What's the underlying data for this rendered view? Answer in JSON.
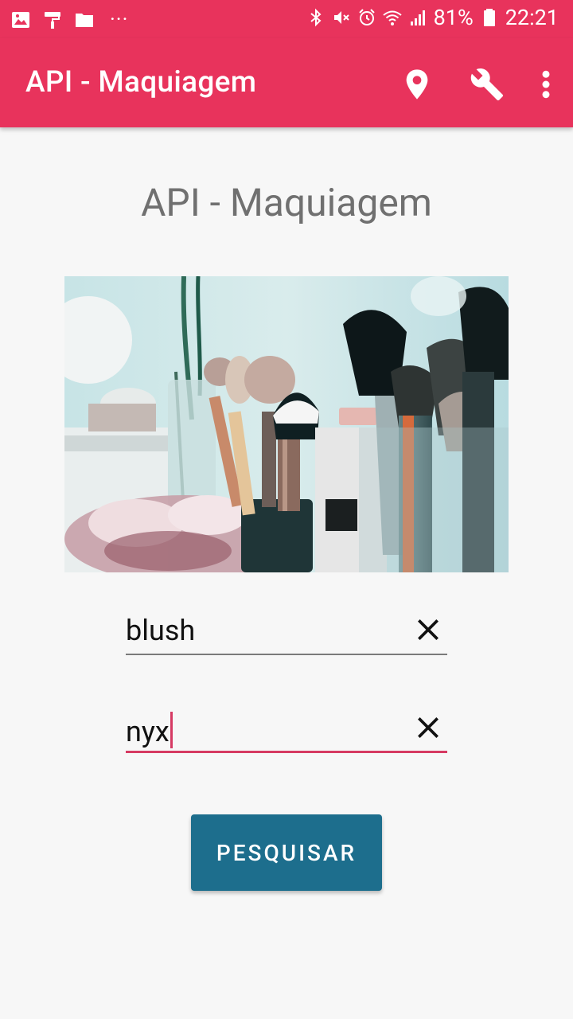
{
  "status_bar": {
    "battery": "81%",
    "time": "22:21",
    "more": "···"
  },
  "app_bar": {
    "title": "API - Maquiagem"
  },
  "main": {
    "title": "API - Maquiagem"
  },
  "form": {
    "product_type_value": "blush",
    "brand_value": "nyx",
    "search_label": "PESQUISAR"
  },
  "colors": {
    "primary": "#e8335c",
    "accent": "#d63a63",
    "button": "#1d6e8d"
  }
}
